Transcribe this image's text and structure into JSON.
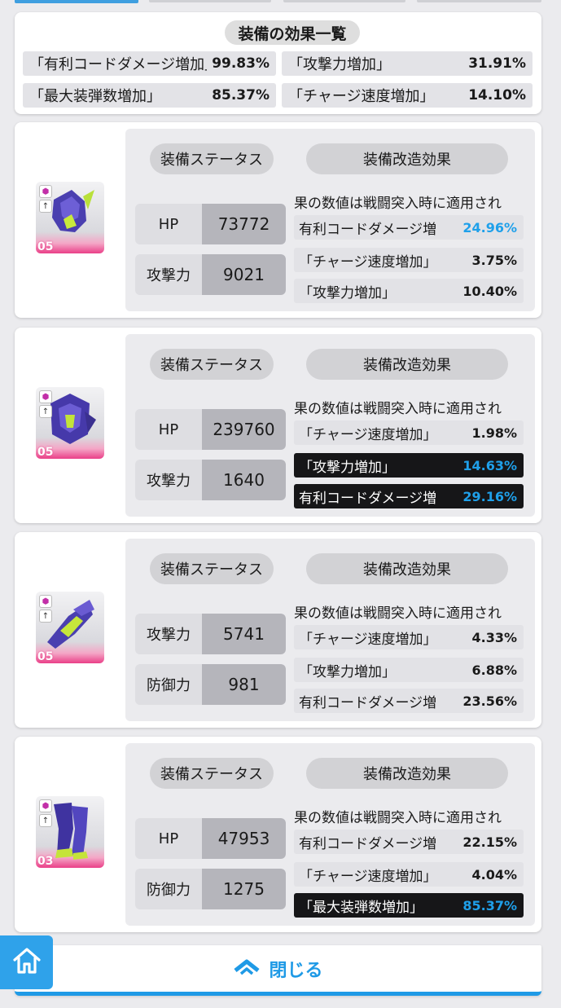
{
  "colors": {
    "accent": "#1f9ae6",
    "highlight_value": "#1fa0ea",
    "dark_row": "#161618",
    "rarity": "#ea3f88"
  },
  "summary": {
    "title": "装備の効果一覧",
    "rows": [
      {
        "label": "「有利コードダメージ増加」",
        "value": "99.83%"
      },
      {
        "label": "「攻撃力増加」",
        "value": "31.91%"
      },
      {
        "label": "「最大装弾数増加」",
        "value": "85.37%"
      },
      {
        "label": "「チャージ速度増加」",
        "value": "14.10%"
      }
    ]
  },
  "equipment": [
    {
      "slot": "head",
      "icon": "head-gear-icon",
      "level": "05",
      "status_label": "装備ステータス",
      "mod_label": "装備改造効果",
      "stats": [
        {
          "label": "HP",
          "value": "73772"
        },
        {
          "label": "攻撃力",
          "value": "9021"
        }
      ],
      "note": "果の数値は戦闘突入時に適用され",
      "mods": [
        {
          "label": "有利コードダメージ増",
          "value": "24.96%",
          "highlight": false,
          "blue": true
        },
        {
          "label": "「チャージ速度増加」",
          "value": "3.75%",
          "highlight": false,
          "blue": false
        },
        {
          "label": "「攻撃力増加」",
          "value": "10.40%",
          "highlight": false,
          "blue": false
        }
      ]
    },
    {
      "slot": "body",
      "icon": "body-armor-icon",
      "level": "05",
      "status_label": "装備ステータス",
      "mod_label": "装備改造効果",
      "stats": [
        {
          "label": "HP",
          "value": "239760"
        },
        {
          "label": "攻撃力",
          "value": "1640"
        }
      ],
      "note": "果の数値は戦闘突入時に適用され",
      "mods": [
        {
          "label": "「チャージ速度増加」",
          "value": "1.98%",
          "highlight": false,
          "blue": false
        },
        {
          "label": "「攻撃力増加」",
          "value": "14.63%",
          "highlight": true,
          "blue": true
        },
        {
          "label": "有利コードダメージ増",
          "value": "29.16%",
          "highlight": true,
          "blue": true
        }
      ]
    },
    {
      "slot": "arm",
      "icon": "arm-gear-icon",
      "level": "05",
      "status_label": "装備ステータス",
      "mod_label": "装備改造効果",
      "stats": [
        {
          "label": "攻撃力",
          "value": "5741"
        },
        {
          "label": "防御力",
          "value": "981"
        }
      ],
      "note": "果の数値は戦闘突入時に適用され",
      "mods": [
        {
          "label": "「チャージ速度増加」",
          "value": "4.33%",
          "highlight": false,
          "blue": false
        },
        {
          "label": "「攻撃力増加」",
          "value": "6.88%",
          "highlight": false,
          "blue": false
        },
        {
          "label": "有利コードダメージ増",
          "value": "23.56%",
          "highlight": false,
          "blue": false
        }
      ]
    },
    {
      "slot": "leg",
      "icon": "leg-gear-icon",
      "level": "03",
      "status_label": "装備ステータス",
      "mod_label": "装備改造効果",
      "stats": [
        {
          "label": "HP",
          "value": "47953"
        },
        {
          "label": "防御力",
          "value": "1275"
        }
      ],
      "note": "果の数値は戦闘突入時に適用され",
      "mods": [
        {
          "label": "有利コードダメージ増",
          "value": "22.15%",
          "highlight": false,
          "blue": false
        },
        {
          "label": "「チャージ速度増加」",
          "value": "4.04%",
          "highlight": false,
          "blue": false
        },
        {
          "label": "「最大装弾数増加」",
          "value": "85.37%",
          "highlight": true,
          "blue": true
        }
      ]
    }
  ],
  "footer": {
    "close_label": "閉じる",
    "home_icon": "home-icon",
    "close_icon": "chevron-up-icon"
  }
}
